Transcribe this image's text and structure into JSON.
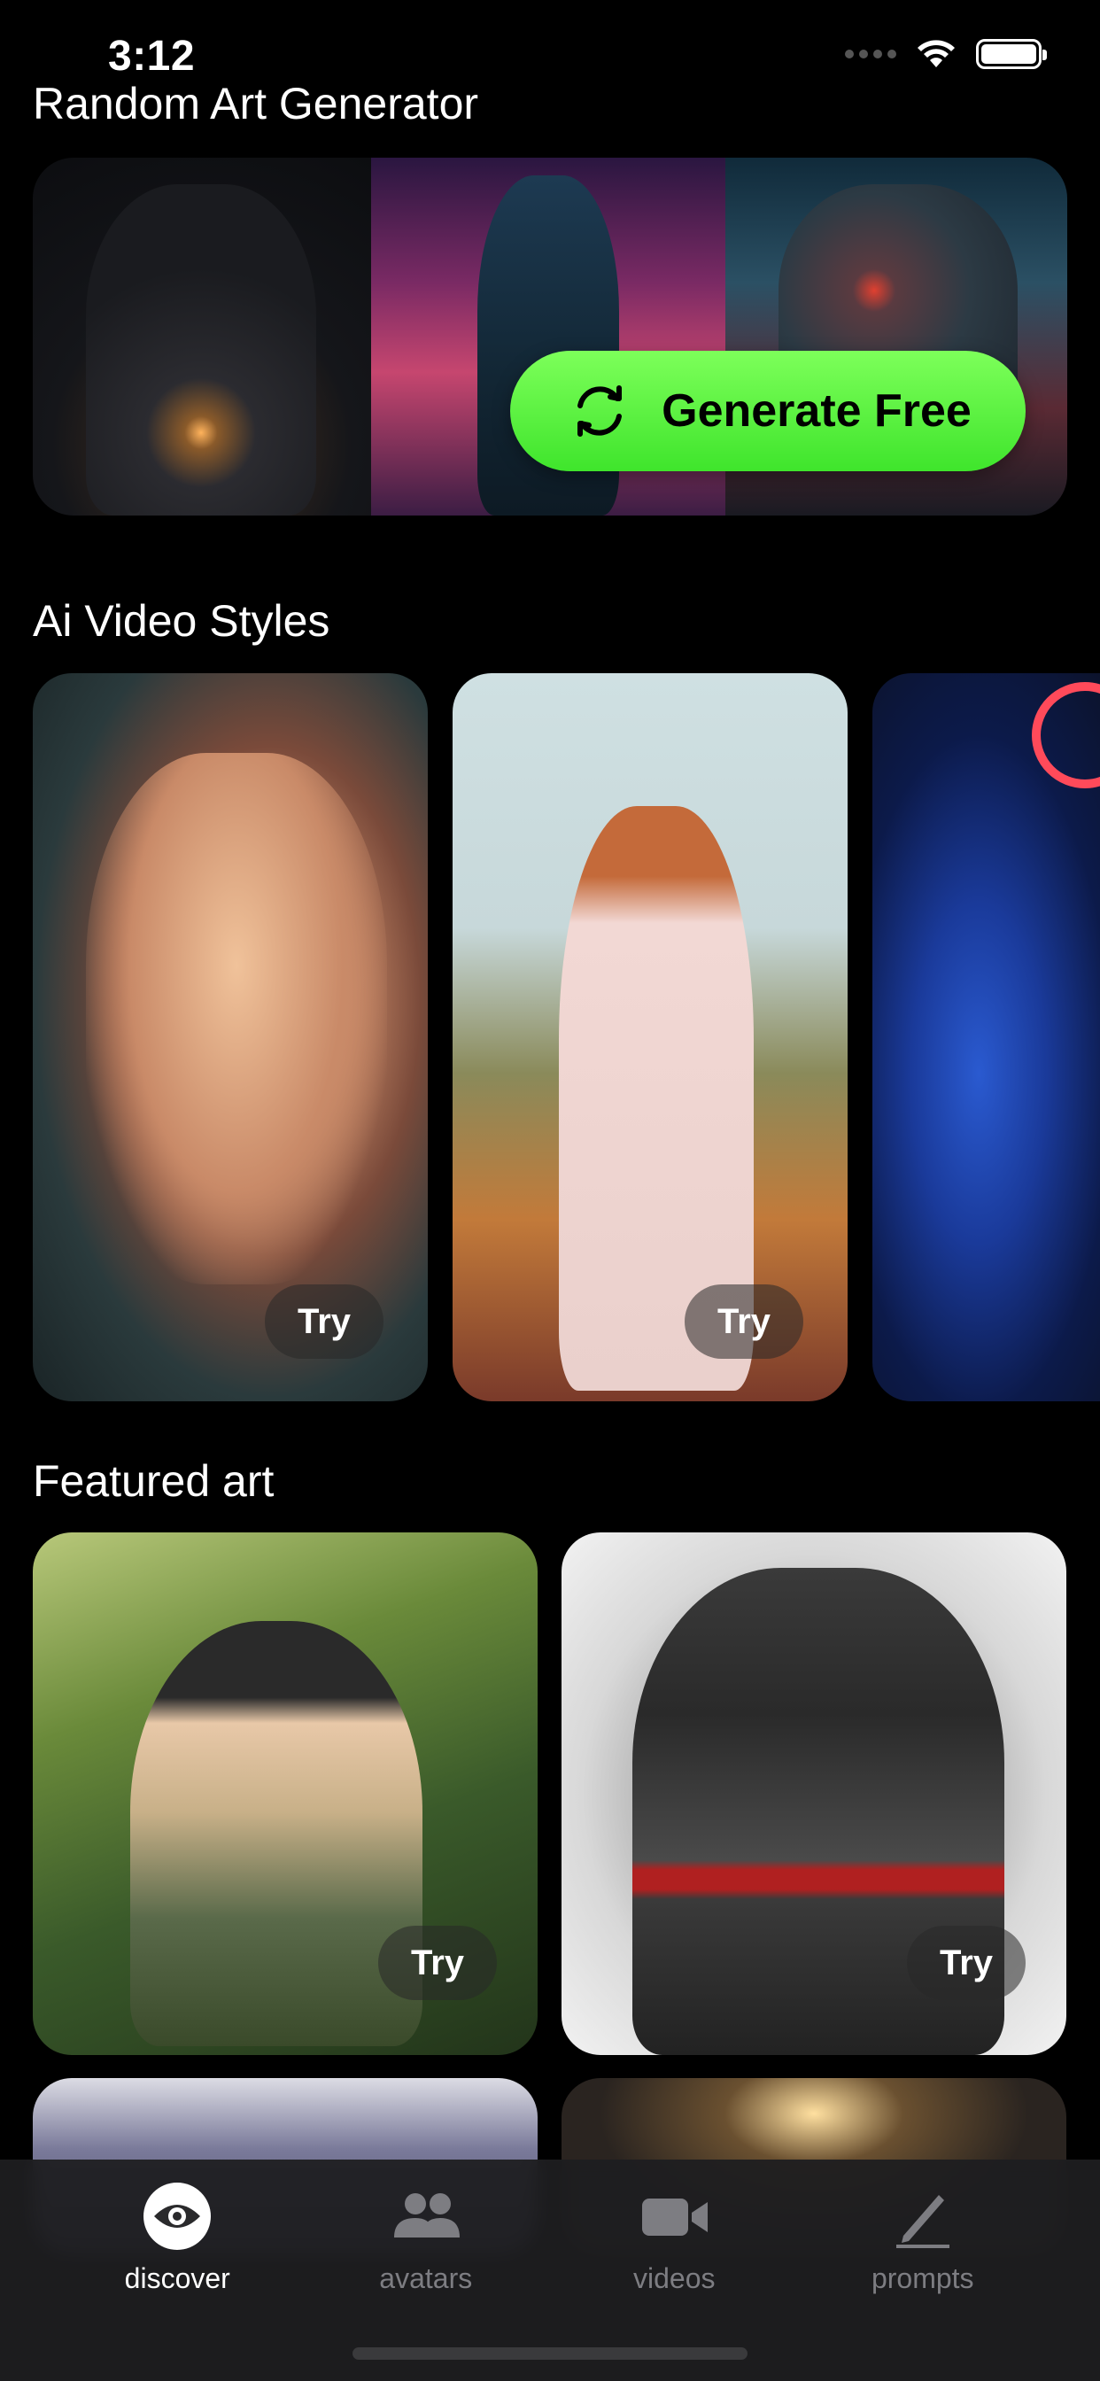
{
  "status": {
    "time": "3:12"
  },
  "app": {
    "title": "Random Art Generator"
  },
  "hero": {
    "button_label": "Generate Free",
    "button_icon": "refresh-icon",
    "accent": "#52f23a"
  },
  "sections": {
    "video_styles": {
      "title": "Ai Video Styles",
      "cards": [
        {
          "try_label": "Try"
        },
        {
          "try_label": "Try"
        }
      ]
    },
    "featured": {
      "title": "Featured art",
      "cards": [
        {
          "try_label": "Try"
        },
        {
          "try_label": "Try"
        }
      ]
    }
  },
  "tabs": [
    {
      "label": "discover",
      "icon": "eye-icon",
      "active": true
    },
    {
      "label": "avatars",
      "icon": "people-icon",
      "active": false
    },
    {
      "label": "videos",
      "icon": "video-camera-icon",
      "active": false
    },
    {
      "label": "prompts",
      "icon": "pencil-icon",
      "active": false
    }
  ]
}
